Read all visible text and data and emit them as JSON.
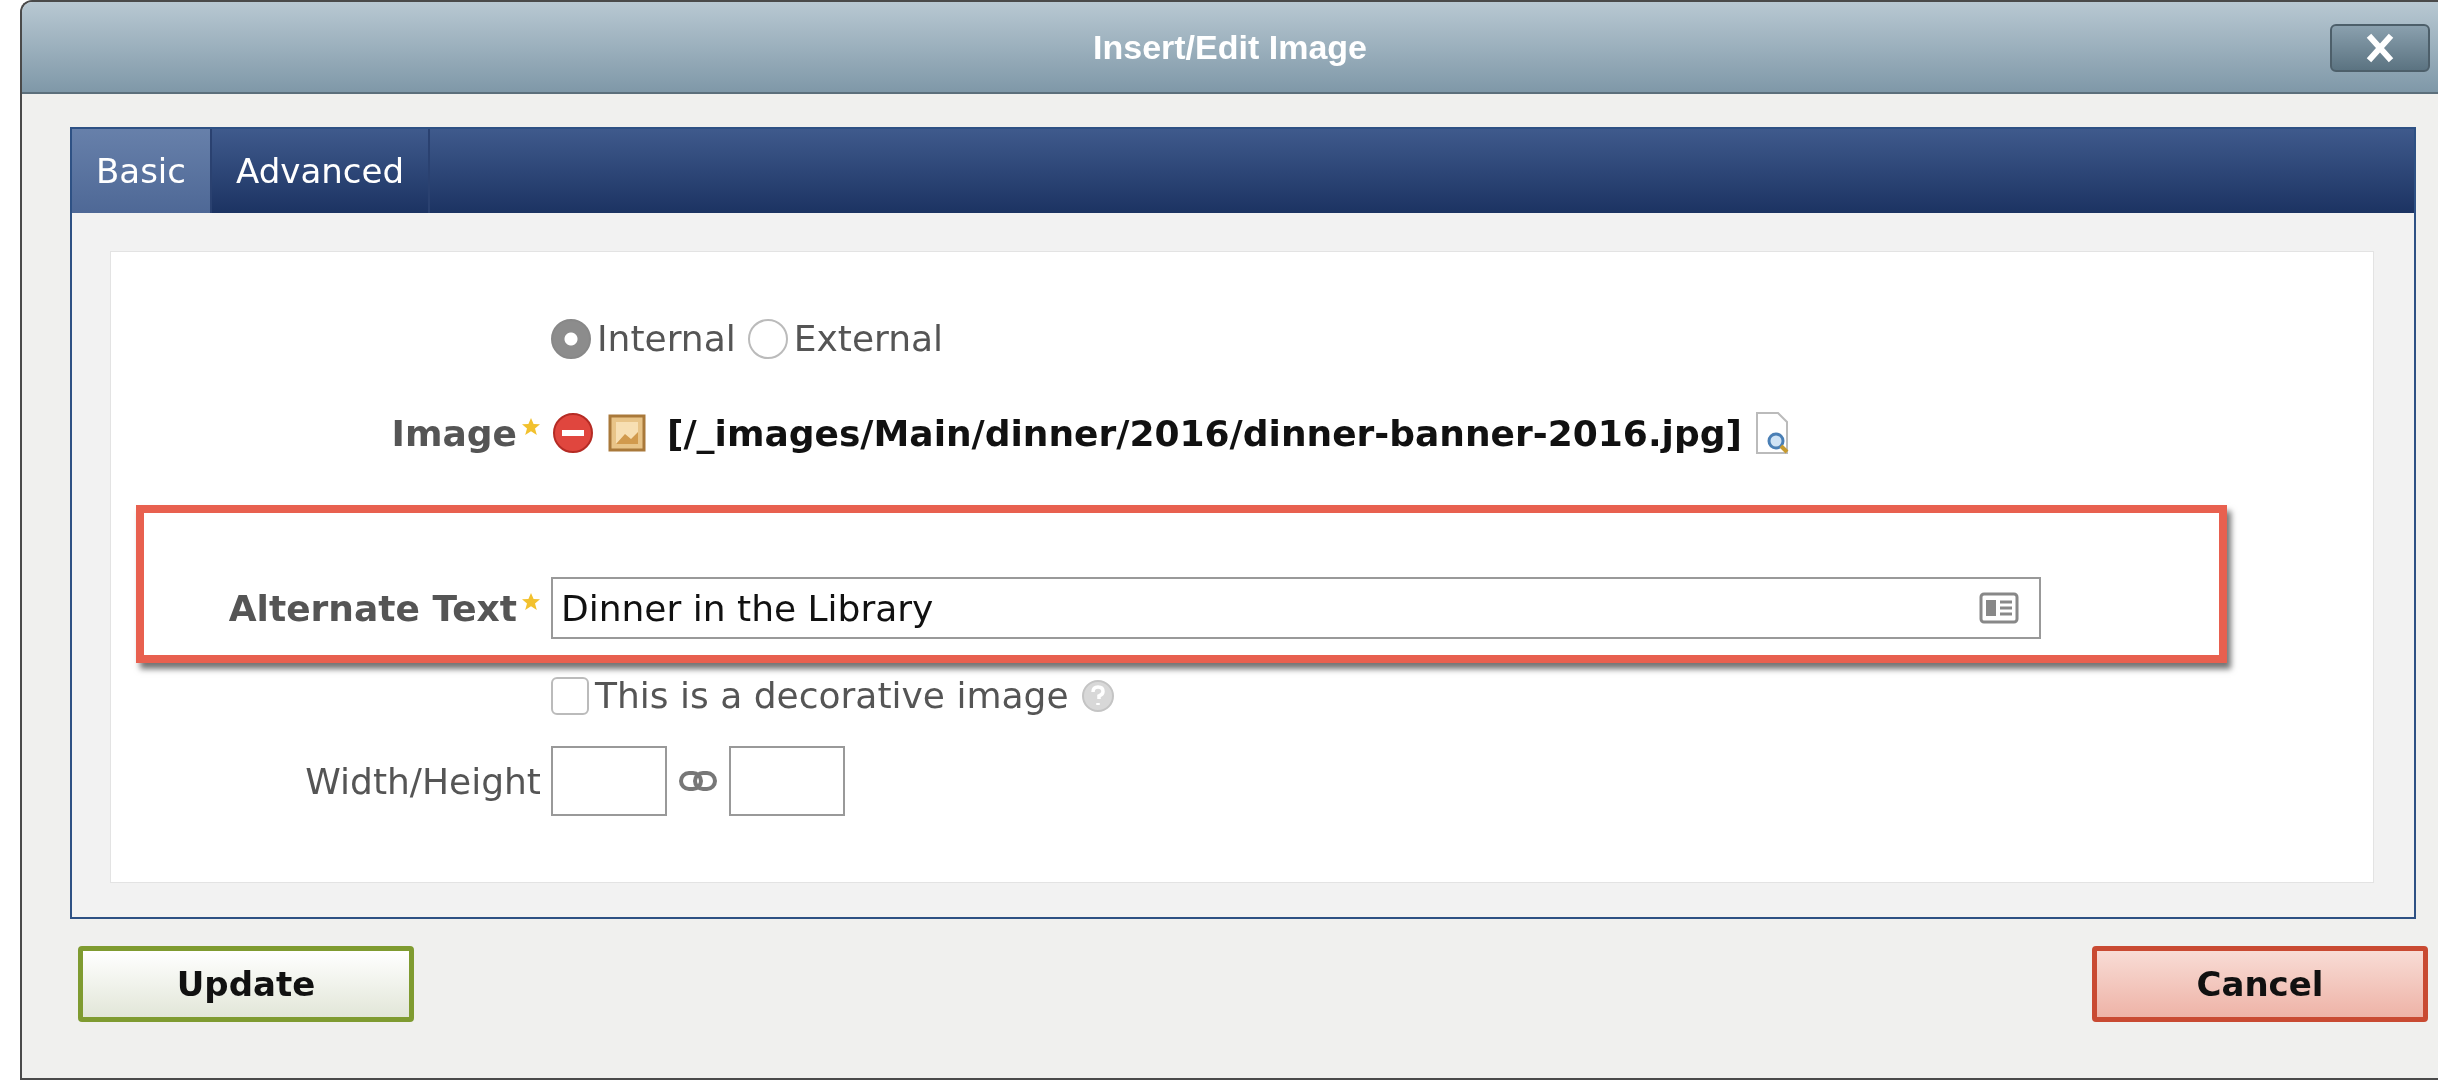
{
  "window": {
    "title": "Insert/Edit Image"
  },
  "tabs": [
    {
      "label": "Basic",
      "selected": true
    },
    {
      "label": "Advanced",
      "selected": false
    }
  ],
  "source_options": [
    {
      "label": "Internal",
      "selected": true
    },
    {
      "label": "External",
      "selected": false
    }
  ],
  "image": {
    "label": "Image",
    "required": true,
    "path": "[/_images/Main/dinner/2016/dinner-banner-2016.jpg]"
  },
  "alt_text": {
    "label": "Alternate Text",
    "required": true,
    "value": "Dinner in the Library",
    "highlighted": true
  },
  "decorative": {
    "label": "This is a decorative image",
    "checked": false
  },
  "dimensions": {
    "label": "Width/Height"
  },
  "buttons": [
    {
      "label": "Update",
      "kind": "primary"
    },
    {
      "label": "Cancel",
      "kind": "cancel"
    }
  ]
}
